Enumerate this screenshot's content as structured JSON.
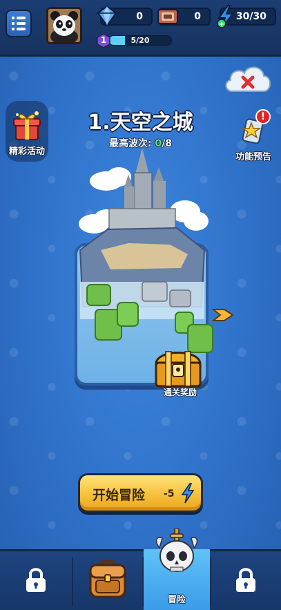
{
  "top_bar": {
    "gems": "0",
    "tickets": "0",
    "energy": "30/30",
    "player_level": "1",
    "xp_text": "5/20",
    "xp_progress": 0.25
  },
  "side": {
    "event_label": "精彩活动",
    "preview_label": "功能预告",
    "preview_alert": "!"
  },
  "level": {
    "title": "1.天空之城",
    "waves_label": "最高波次:",
    "waves_current": "0",
    "waves_total": "/8",
    "reward_label": "通关奖励"
  },
  "start": {
    "label": "开始冒险",
    "cost": "-5"
  },
  "bottom_nav": {
    "adventure_label": "冒险"
  },
  "colors": {
    "background": "#2f71c9",
    "accent_gold": "#f6c13a",
    "energy_blue": "#2f8ff0",
    "xp_fill": "#5fd0f5",
    "active_tab": "#4bb0f0"
  },
  "icons": {
    "menu": "menu-icon",
    "gem": "gem-icon",
    "ticket": "ticket-icon",
    "energy": "lightning-icon",
    "cloud_close": "cloud-close-icon",
    "event": "gift-icon",
    "preview": "star-card-icon",
    "chest": "treasure-chest-icon",
    "lock": "lock-icon",
    "backpack": "backpack-icon",
    "skull": "skull-helmet-icon"
  }
}
